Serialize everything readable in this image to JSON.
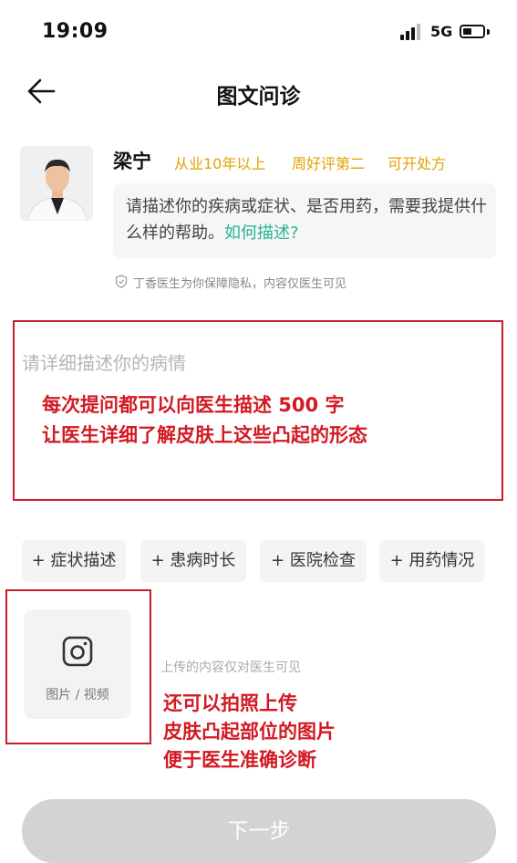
{
  "status_bar": {
    "time": "19:09",
    "network": "5G"
  },
  "header": {
    "title": "图文问诊"
  },
  "doctor": {
    "name": "梁宁",
    "tags": [
      "从业10年以上",
      "周好评第二",
      "可开处方"
    ],
    "message": "请描述你的疾病或症状、是否用药，需要我提供什么样的帮助。",
    "help_link": "如何描述?",
    "privacy_note": "丁香医生为你保障隐私，内容仅医生可见"
  },
  "description": {
    "placeholder": "请详细描述你的病情",
    "annotation_lines": [
      "每次提问都可以向医生描述 500 字",
      "让医生详细了解皮肤上这些凸起的形态"
    ]
  },
  "chips": [
    "+ 症状描述",
    "+ 患病时长",
    "+ 医院检查",
    "+ 用药情况"
  ],
  "upload": {
    "label": "图片 / 视频",
    "note": "上传的内容仅对医生可见",
    "annotation_lines": [
      "还可以拍照上传",
      "皮肤凸起部位的图片",
      "便于医生准确诊断"
    ]
  },
  "next_button": {
    "label": "下一步"
  },
  "colors": {
    "accent_red": "#d21a24",
    "tag_gold": "#e2a200",
    "link_green": "#27b48f",
    "disabled_button": "#d3d3d3"
  }
}
